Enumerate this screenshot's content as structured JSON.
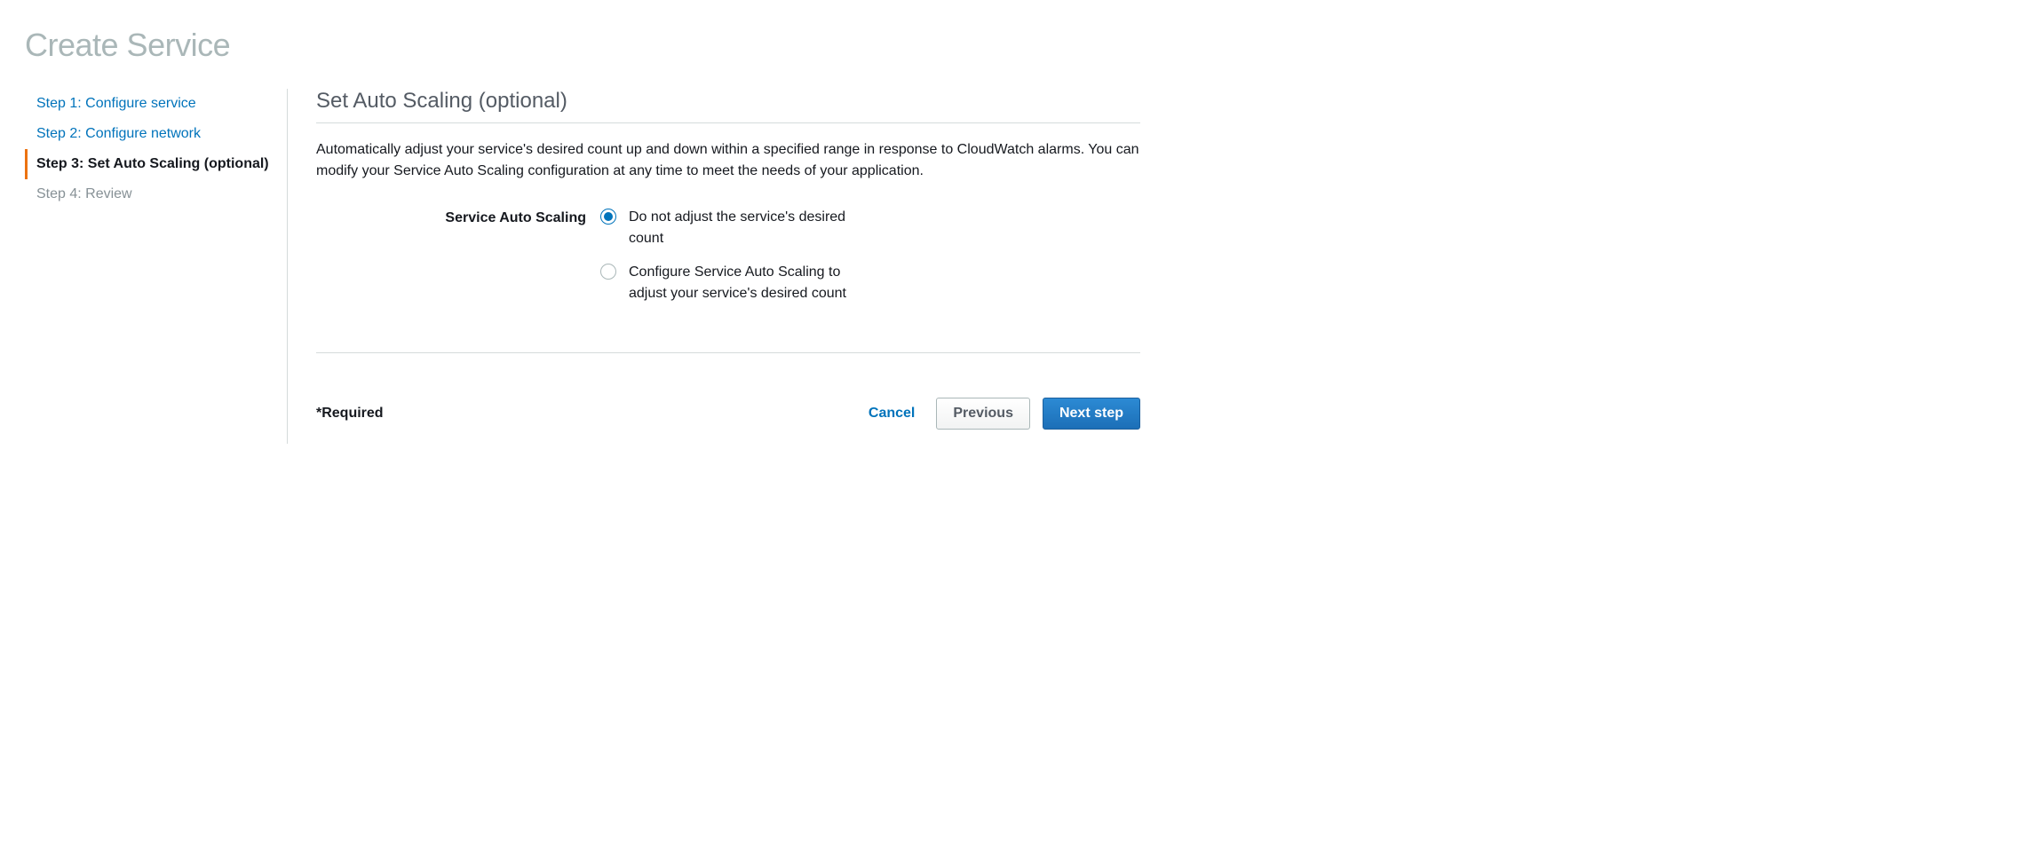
{
  "page_title": "Create Service",
  "sidebar": {
    "steps": [
      {
        "label": "Step 1: Configure service",
        "state": "link"
      },
      {
        "label": "Step 2: Configure network",
        "state": "link"
      },
      {
        "label": "Step 3: Set Auto Scaling (optional)",
        "state": "active"
      },
      {
        "label": "Step 4: Review",
        "state": "disabled"
      }
    ]
  },
  "main": {
    "section_title": "Set Auto Scaling (optional)",
    "section_description": "Automatically adjust your service's desired count up and down within a specified range in response to CloudWatch alarms. You can modify your Service Auto Scaling configuration at any time to meet the needs of your application.",
    "form": {
      "label": "Service Auto Scaling",
      "options": [
        {
          "text": "Do not adjust the service's desired count",
          "selected": true
        },
        {
          "text": "Configure Service Auto Scaling to adjust your service's desired count",
          "selected": false
        }
      ]
    },
    "required_note": "*Required",
    "actions": {
      "cancel": "Cancel",
      "previous": "Previous",
      "next": "Next step"
    }
  }
}
